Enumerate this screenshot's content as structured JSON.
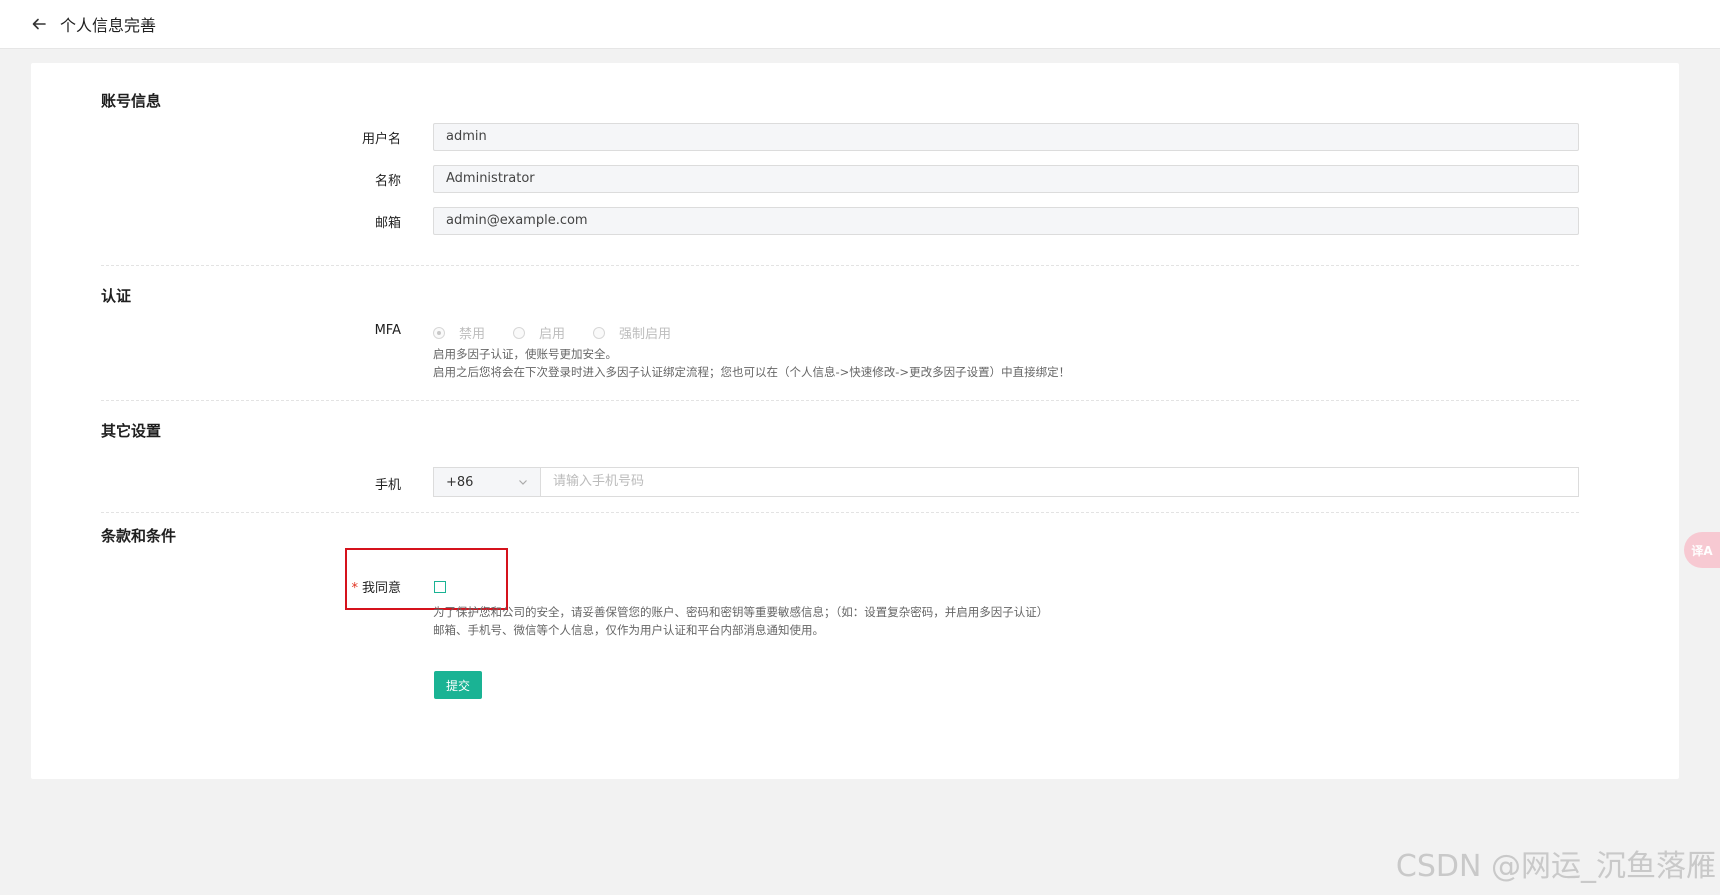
{
  "header": {
    "title": "个人信息完善"
  },
  "account": {
    "section_title": "账号信息",
    "fields": [
      {
        "label": "用户名",
        "value": "admin"
      },
      {
        "label": "名称",
        "value": "Administrator"
      },
      {
        "label": "邮箱",
        "value": "admin@example.com"
      }
    ]
  },
  "auth": {
    "section_title": "认证",
    "mfa_label": "MFA",
    "options": [
      "禁用",
      "启用",
      "强制启用"
    ],
    "selected": "禁用",
    "help_line1": "启用多因子认证，使账号更加安全。",
    "help_line2": "启用之后您将会在下次登录时进入多因子认证绑定流程；您也可以在（个人信息->快速修改->更改多因子设置）中直接绑定！"
  },
  "other": {
    "section_title": "其它设置",
    "phone_label": "手机",
    "country_code": "+86",
    "phone_placeholder": "请输入手机号码"
  },
  "terms": {
    "section_title": "条款和条件",
    "agree_label": "我同意",
    "required_mark": "*",
    "agree_checked": false,
    "help_line1": "为了保护您和公司的安全，请妥善保管您的账户、密码和密钥等重要敏感信息；（如：设置复杂密码，并启用多因子认证）",
    "help_line2": "邮箱、手机号、微信等个人信息，仅作为用户认证和平台内部消息通知使用。"
  },
  "submit_label": "提交",
  "translate_fab_label": "译A",
  "watermark": "CSDN @网运_沉鱼落雁",
  "colors": {
    "accent": "#1ab394",
    "highlight": "#d5121c",
    "required": "#e0301e"
  }
}
